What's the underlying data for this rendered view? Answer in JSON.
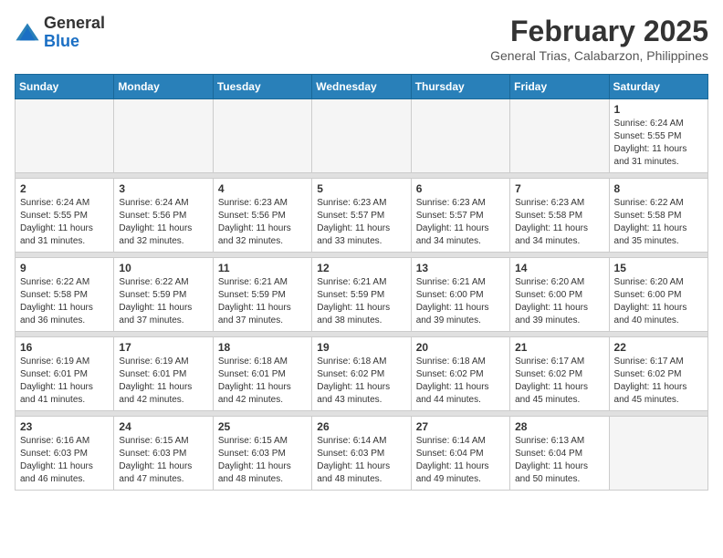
{
  "header": {
    "logo_general": "General",
    "logo_blue": "Blue",
    "month_year": "February 2025",
    "location": "General Trias, Calabarzon, Philippines"
  },
  "weekdays": [
    "Sunday",
    "Monday",
    "Tuesday",
    "Wednesday",
    "Thursday",
    "Friday",
    "Saturday"
  ],
  "weeks": [
    [
      {
        "day": "",
        "info": ""
      },
      {
        "day": "",
        "info": ""
      },
      {
        "day": "",
        "info": ""
      },
      {
        "day": "",
        "info": ""
      },
      {
        "day": "",
        "info": ""
      },
      {
        "day": "",
        "info": ""
      },
      {
        "day": "1",
        "info": "Sunrise: 6:24 AM\nSunset: 5:55 PM\nDaylight: 11 hours and 31 minutes."
      }
    ],
    [
      {
        "day": "2",
        "info": "Sunrise: 6:24 AM\nSunset: 5:55 PM\nDaylight: 11 hours and 31 minutes."
      },
      {
        "day": "3",
        "info": "Sunrise: 6:24 AM\nSunset: 5:56 PM\nDaylight: 11 hours and 32 minutes."
      },
      {
        "day": "4",
        "info": "Sunrise: 6:23 AM\nSunset: 5:56 PM\nDaylight: 11 hours and 32 minutes."
      },
      {
        "day": "5",
        "info": "Sunrise: 6:23 AM\nSunset: 5:57 PM\nDaylight: 11 hours and 33 minutes."
      },
      {
        "day": "6",
        "info": "Sunrise: 6:23 AM\nSunset: 5:57 PM\nDaylight: 11 hours and 34 minutes."
      },
      {
        "day": "7",
        "info": "Sunrise: 6:23 AM\nSunset: 5:58 PM\nDaylight: 11 hours and 34 minutes."
      },
      {
        "day": "8",
        "info": "Sunrise: 6:22 AM\nSunset: 5:58 PM\nDaylight: 11 hours and 35 minutes."
      }
    ],
    [
      {
        "day": "9",
        "info": "Sunrise: 6:22 AM\nSunset: 5:58 PM\nDaylight: 11 hours and 36 minutes."
      },
      {
        "day": "10",
        "info": "Sunrise: 6:22 AM\nSunset: 5:59 PM\nDaylight: 11 hours and 37 minutes."
      },
      {
        "day": "11",
        "info": "Sunrise: 6:21 AM\nSunset: 5:59 PM\nDaylight: 11 hours and 37 minutes."
      },
      {
        "day": "12",
        "info": "Sunrise: 6:21 AM\nSunset: 5:59 PM\nDaylight: 11 hours and 38 minutes."
      },
      {
        "day": "13",
        "info": "Sunrise: 6:21 AM\nSunset: 6:00 PM\nDaylight: 11 hours and 39 minutes."
      },
      {
        "day": "14",
        "info": "Sunrise: 6:20 AM\nSunset: 6:00 PM\nDaylight: 11 hours and 39 minutes."
      },
      {
        "day": "15",
        "info": "Sunrise: 6:20 AM\nSunset: 6:00 PM\nDaylight: 11 hours and 40 minutes."
      }
    ],
    [
      {
        "day": "16",
        "info": "Sunrise: 6:19 AM\nSunset: 6:01 PM\nDaylight: 11 hours and 41 minutes."
      },
      {
        "day": "17",
        "info": "Sunrise: 6:19 AM\nSunset: 6:01 PM\nDaylight: 11 hours and 42 minutes."
      },
      {
        "day": "18",
        "info": "Sunrise: 6:18 AM\nSunset: 6:01 PM\nDaylight: 11 hours and 42 minutes."
      },
      {
        "day": "19",
        "info": "Sunrise: 6:18 AM\nSunset: 6:02 PM\nDaylight: 11 hours and 43 minutes."
      },
      {
        "day": "20",
        "info": "Sunrise: 6:18 AM\nSunset: 6:02 PM\nDaylight: 11 hours and 44 minutes."
      },
      {
        "day": "21",
        "info": "Sunrise: 6:17 AM\nSunset: 6:02 PM\nDaylight: 11 hours and 45 minutes."
      },
      {
        "day": "22",
        "info": "Sunrise: 6:17 AM\nSunset: 6:02 PM\nDaylight: 11 hours and 45 minutes."
      }
    ],
    [
      {
        "day": "23",
        "info": "Sunrise: 6:16 AM\nSunset: 6:03 PM\nDaylight: 11 hours and 46 minutes."
      },
      {
        "day": "24",
        "info": "Sunrise: 6:15 AM\nSunset: 6:03 PM\nDaylight: 11 hours and 47 minutes."
      },
      {
        "day": "25",
        "info": "Sunrise: 6:15 AM\nSunset: 6:03 PM\nDaylight: 11 hours and 48 minutes."
      },
      {
        "day": "26",
        "info": "Sunrise: 6:14 AM\nSunset: 6:03 PM\nDaylight: 11 hours and 48 minutes."
      },
      {
        "day": "27",
        "info": "Sunrise: 6:14 AM\nSunset: 6:04 PM\nDaylight: 11 hours and 49 minutes."
      },
      {
        "day": "28",
        "info": "Sunrise: 6:13 AM\nSunset: 6:04 PM\nDaylight: 11 hours and 50 minutes."
      },
      {
        "day": "",
        "info": ""
      }
    ]
  ]
}
